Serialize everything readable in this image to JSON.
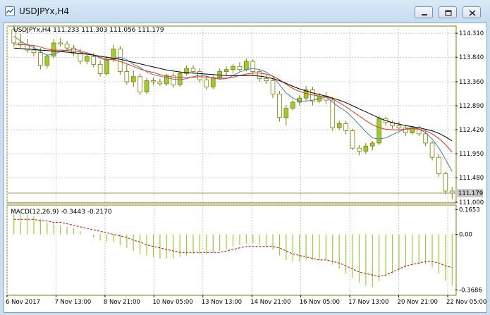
{
  "window": {
    "title": "USDJPYx,H4",
    "minimize_icon": "minimize-icon",
    "restore_icon": "restore-icon",
    "close_icon": "close-icon",
    "app_icon": "chart-window-icon"
  },
  "colors": {
    "candle_bull": "#9acd32",
    "candle_bear": "#ffffff",
    "candle_outline": "#808000",
    "ma_fast": "#4682b4",
    "ma_mid": "#ff2a00",
    "ma_slow": "#000000",
    "macd_hist": "#9acd32",
    "macd_signal": "#d20000",
    "price_line": "#808000",
    "text": "#000000",
    "current_price_tag": "#c8c8c8"
  },
  "chart_data": {
    "type": "candlestick",
    "symbol_info": "USDJPYx,H4  111.233 111.303 111.056 111.179",
    "current_price_label": "111.179",
    "current_price": 111.179,
    "y_range": [
      111.0,
      114.45
    ],
    "price_ticks": [
      "114.310",
      "113.840",
      "113.360",
      "112.890",
      "112.420",
      "111.950",
      "111.480",
      "111.000"
    ],
    "price_tick_values": [
      114.31,
      113.84,
      113.36,
      112.89,
      112.42,
      111.95,
      111.48,
      111.0
    ],
    "date_labels": [
      "6 Nov 2017",
      "7 Nov 13:00",
      "8 Nov 21:00",
      "10 Nov 05:00",
      "13 Nov 13:00",
      "14 Nov 21:00",
      "16 Nov 05:00",
      "17 Nov 13:00",
      "20 Nov 21:00",
      "22 Nov 05:00"
    ],
    "candles": [
      [
        114.38,
        114.45,
        114.05,
        114.12
      ],
      [
        114.12,
        114.3,
        114.02,
        114.08
      ],
      [
        114.08,
        114.2,
        113.92,
        113.98
      ],
      [
        113.98,
        114.06,
        113.86,
        113.93
      ],
      [
        113.93,
        114.02,
        113.6,
        113.68
      ],
      [
        113.68,
        113.9,
        113.62,
        113.86
      ],
      [
        113.86,
        114.2,
        113.82,
        114.12
      ],
      [
        114.12,
        114.22,
        114.05,
        114.1
      ],
      [
        114.1,
        114.16,
        113.98,
        114.02
      ],
      [
        114.02,
        114.08,
        113.86,
        113.92
      ],
      [
        113.92,
        114.0,
        113.7,
        113.76
      ],
      [
        113.76,
        113.9,
        113.7,
        113.85
      ],
      [
        113.85,
        113.92,
        113.64,
        113.7
      ],
      [
        113.7,
        113.78,
        113.46,
        113.52
      ],
      [
        113.52,
        113.86,
        113.48,
        113.8
      ],
      [
        113.8,
        114.08,
        113.74,
        114.0
      ],
      [
        114.0,
        114.06,
        113.5,
        113.56
      ],
      [
        113.56,
        113.7,
        113.3,
        113.36
      ],
      [
        113.36,
        113.58,
        113.26,
        113.46
      ],
      [
        113.46,
        113.52,
        113.1,
        113.16
      ],
      [
        113.16,
        113.44,
        113.12,
        113.38
      ],
      [
        113.38,
        113.44,
        113.3,
        113.36
      ],
      [
        113.36,
        113.42,
        113.28,
        113.32
      ],
      [
        113.32,
        113.52,
        113.28,
        113.48
      ],
      [
        113.48,
        113.54,
        113.24,
        113.3
      ],
      [
        113.3,
        113.58,
        113.26,
        113.52
      ],
      [
        113.52,
        113.68,
        113.48,
        113.62
      ],
      [
        113.62,
        113.68,
        113.52,
        113.56
      ],
      [
        113.56,
        113.62,
        113.34,
        113.4
      ],
      [
        113.4,
        113.48,
        113.2,
        113.26
      ],
      [
        113.26,
        113.48,
        113.22,
        113.44
      ],
      [
        113.44,
        113.62,
        113.4,
        113.56
      ],
      [
        113.56,
        113.66,
        113.48,
        113.6
      ],
      [
        113.6,
        113.7,
        113.52,
        113.66
      ],
      [
        113.66,
        113.74,
        113.56,
        113.6
      ],
      [
        113.6,
        113.82,
        113.56,
        113.76
      ],
      [
        113.76,
        113.8,
        113.5,
        113.56
      ],
      [
        113.56,
        113.6,
        113.36,
        113.42
      ],
      [
        113.42,
        113.5,
        113.32,
        113.38
      ],
      [
        113.38,
        113.44,
        113.04,
        113.12
      ],
      [
        113.12,
        113.18,
        112.58,
        112.66
      ],
      [
        112.66,
        112.9,
        112.5,
        112.84
      ],
      [
        112.84,
        113.0,
        112.8,
        112.96
      ],
      [
        112.96,
        113.1,
        112.9,
        113.04
      ],
      [
        113.04,
        113.28,
        112.98,
        113.2
      ],
      [
        113.2,
        113.26,
        112.9,
        112.98
      ],
      [
        112.98,
        113.14,
        112.94,
        113.08
      ],
      [
        113.08,
        113.16,
        112.92,
        113.0
      ],
      [
        113.0,
        113.06,
        112.4,
        112.46
      ],
      [
        112.46,
        112.6,
        112.42,
        112.54
      ],
      [
        112.54,
        112.6,
        112.34,
        112.4
      ],
      [
        112.4,
        112.44,
        112.02,
        112.06
      ],
      [
        112.06,
        112.12,
        111.92,
        112.0
      ],
      [
        112.0,
        112.16,
        111.94,
        112.1
      ],
      [
        112.1,
        112.2,
        112.02,
        112.16
      ],
      [
        112.16,
        112.7,
        112.12,
        112.64
      ],
      [
        112.64,
        112.68,
        112.5,
        112.56
      ],
      [
        112.56,
        112.6,
        112.44,
        112.5
      ],
      [
        112.5,
        112.58,
        112.4,
        112.46
      ],
      [
        112.46,
        112.52,
        112.3,
        112.36
      ],
      [
        112.36,
        112.5,
        112.32,
        112.46
      ],
      [
        112.46,
        112.5,
        112.3,
        112.34
      ],
      [
        112.34,
        112.4,
        112.1,
        112.16
      ],
      [
        112.16,
        112.2,
        111.82,
        111.88
      ],
      [
        111.88,
        111.94,
        111.5,
        111.56
      ],
      [
        111.56,
        111.6,
        111.16,
        111.22
      ],
      [
        111.22,
        111.3,
        111.06,
        111.18
      ]
    ],
    "ma_fast": [
      114.25,
      114.16,
      114.08,
      114.03,
      113.95,
      113.88,
      113.9,
      113.95,
      113.98,
      114.0,
      113.97,
      113.93,
      113.89,
      113.82,
      113.78,
      113.82,
      113.84,
      113.79,
      113.7,
      113.64,
      113.55,
      113.5,
      113.47,
      113.44,
      113.41,
      113.4,
      113.42,
      113.46,
      113.49,
      113.47,
      113.43,
      113.41,
      113.42,
      113.48,
      113.55,
      113.6,
      113.62,
      113.6,
      113.55,
      113.46,
      113.3,
      113.14,
      113.04,
      112.98,
      112.98,
      113.0,
      113.03,
      113.06,
      112.96,
      112.86,
      112.78,
      112.66,
      112.52,
      112.38,
      112.26,
      112.24,
      112.26,
      112.32,
      112.38,
      112.44,
      112.46,
      112.44,
      112.36,
      112.24,
      112.06,
      111.84,
      111.6
    ],
    "ma_mid": [
      114.1,
      114.09,
      114.08,
      114.07,
      114.04,
      114.0,
      113.98,
      113.98,
      113.97,
      113.96,
      113.94,
      113.91,
      113.88,
      113.84,
      113.8,
      113.79,
      113.76,
      113.71,
      113.66,
      113.61,
      113.57,
      113.54,
      113.5,
      113.47,
      113.45,
      113.44,
      113.44,
      113.45,
      113.46,
      113.45,
      113.44,
      113.43,
      113.43,
      113.45,
      113.48,
      113.51,
      113.53,
      113.53,
      113.51,
      113.47,
      113.4,
      113.31,
      113.23,
      113.17,
      113.13,
      113.1,
      113.08,
      113.07,
      113.02,
      112.95,
      112.87,
      112.78,
      112.69,
      112.6,
      112.52,
      112.46,
      112.43,
      112.42,
      112.42,
      112.43,
      112.44,
      112.43,
      112.4,
      112.34,
      112.25,
      112.13,
      111.98
    ],
    "ma_slow": [
      114.02,
      114.01,
      114.0,
      113.99,
      113.98,
      113.97,
      113.96,
      113.95,
      113.94,
      113.93,
      113.91,
      113.9,
      113.88,
      113.86,
      113.84,
      113.82,
      113.8,
      113.77,
      113.74,
      113.71,
      113.68,
      113.65,
      113.62,
      113.59,
      113.57,
      113.55,
      113.54,
      113.53,
      113.52,
      113.51,
      113.5,
      113.49,
      113.48,
      113.48,
      113.48,
      113.48,
      113.48,
      113.47,
      113.45,
      113.42,
      113.38,
      113.33,
      113.27,
      113.22,
      113.18,
      113.14,
      113.11,
      113.08,
      113.04,
      113.0,
      112.95,
      112.89,
      112.83,
      112.77,
      112.71,
      112.65,
      112.6,
      112.56,
      112.53,
      112.5,
      112.48,
      112.46,
      112.43,
      112.4,
      112.35,
      112.28,
      112.2
    ],
    "macd": {
      "label": "MACD(12,26,9) -0.3443 -0.2170",
      "y_range": [
        -0.4,
        0.19
      ],
      "ticks": [
        "0.1653",
        "0.00",
        "-0.3686"
      ],
      "tick_values": [
        0.1653,
        0.0,
        -0.3686
      ],
      "histogram": [
        0.15,
        0.14,
        0.13,
        0.12,
        0.1,
        0.08,
        0.07,
        0.06,
        0.05,
        0.04,
        0.02,
        0.0,
        -0.02,
        -0.04,
        -0.05,
        -0.05,
        -0.07,
        -0.09,
        -0.11,
        -0.13,
        -0.14,
        -0.15,
        -0.16,
        -0.16,
        -0.16,
        -0.15,
        -0.14,
        -0.13,
        -0.13,
        -0.13,
        -0.12,
        -0.11,
        -0.1,
        -0.08,
        -0.07,
        -0.06,
        -0.06,
        -0.07,
        -0.08,
        -0.1,
        -0.14,
        -0.17,
        -0.18,
        -0.18,
        -0.17,
        -0.17,
        -0.17,
        -0.17,
        -0.2,
        -0.23,
        -0.26,
        -0.29,
        -0.32,
        -0.34,
        -0.35,
        -0.31,
        -0.28,
        -0.26,
        -0.24,
        -0.22,
        -0.21,
        -0.2,
        -0.2,
        -0.22,
        -0.26,
        -0.31,
        -0.34
      ],
      "signal": [
        0.1,
        0.1,
        0.1,
        0.1,
        0.09,
        0.09,
        0.08,
        0.08,
        0.07,
        0.06,
        0.05,
        0.04,
        0.03,
        0.02,
        0.01,
        0.0,
        -0.01,
        -0.02,
        -0.04,
        -0.05,
        -0.07,
        -0.08,
        -0.09,
        -0.1,
        -0.11,
        -0.12,
        -0.12,
        -0.12,
        -0.12,
        -0.12,
        -0.12,
        -0.12,
        -0.11,
        -0.1,
        -0.09,
        -0.08,
        -0.08,
        -0.08,
        -0.08,
        -0.08,
        -0.09,
        -0.11,
        -0.13,
        -0.14,
        -0.15,
        -0.16,
        -0.17,
        -0.17,
        -0.18,
        -0.19,
        -0.21,
        -0.23,
        -0.25,
        -0.26,
        -0.27,
        -0.28,
        -0.27,
        -0.25,
        -0.23,
        -0.21,
        -0.2,
        -0.19,
        -0.18,
        -0.18,
        -0.19,
        -0.21,
        -0.22
      ]
    }
  }
}
